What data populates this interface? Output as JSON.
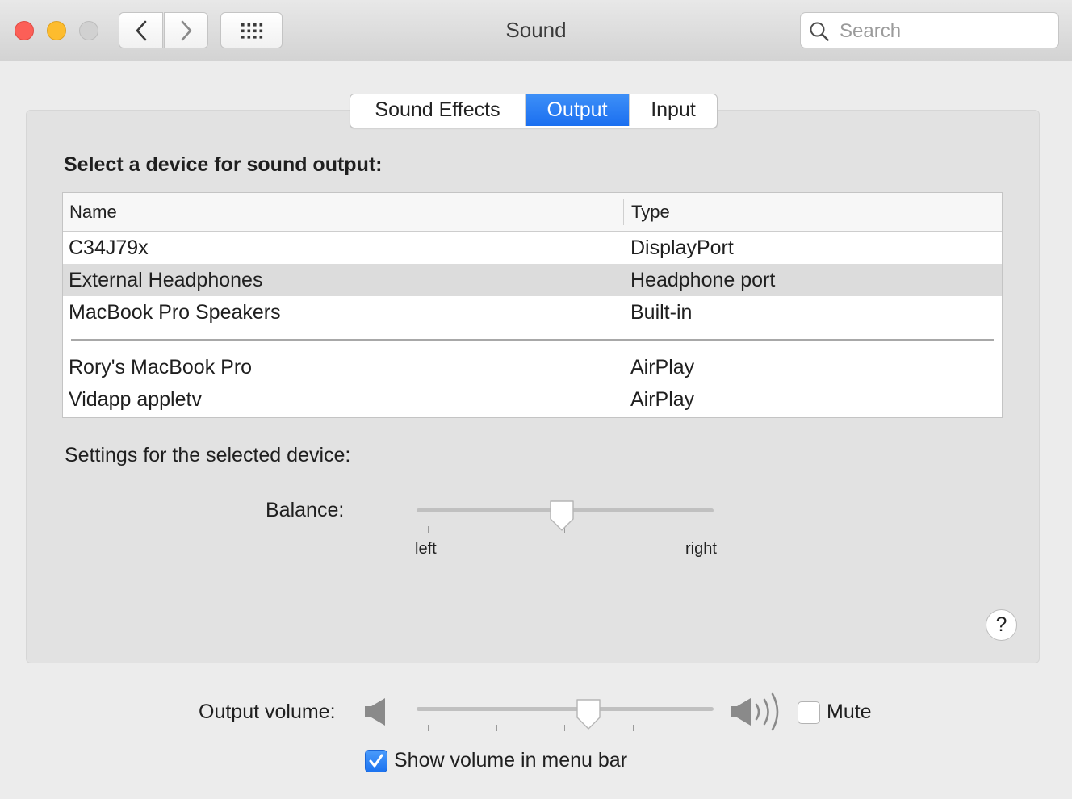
{
  "window": {
    "title": "Sound",
    "traffic_lights": {
      "close": "#fc5f57",
      "minimize": "#fdbc2e",
      "zoom": "#d1d1d1"
    },
    "back_icon": "chevron-left-icon",
    "forward_icon": "chevron-right-icon",
    "grid_icon": "show-all-grid-icon"
  },
  "search": {
    "placeholder": "Search",
    "value": ""
  },
  "tabs": [
    {
      "label": "Sound Effects",
      "active": false
    },
    {
      "label": "Output",
      "active": true
    },
    {
      "label": "Input",
      "active": false
    }
  ],
  "accent_color": "#1b6ff0",
  "output": {
    "heading": "Select a device for sound output:",
    "columns": {
      "name": "Name",
      "type": "Type"
    },
    "devices": [
      {
        "name": "C34J79x",
        "type": "DisplayPort",
        "selected": false
      },
      {
        "name": "External Headphones",
        "type": "Headphone port",
        "selected": true
      },
      {
        "name": "MacBook Pro Speakers",
        "type": "Built-in",
        "selected": false
      }
    ],
    "airplay_devices": [
      {
        "name": "Rory's MacBook Pro",
        "type": "AirPlay"
      },
      {
        "name": "Vidapp appletv",
        "type": "AirPlay"
      }
    ]
  },
  "settings": {
    "heading": "Settings for the selected device:",
    "balance": {
      "label": "Balance:",
      "left_label": "left",
      "right_label": "right",
      "value": 0.49
    }
  },
  "help_button": {
    "label": "?"
  },
  "volume": {
    "label": "Output volume:",
    "value": 0.58,
    "low_icon": "speaker-low-icon",
    "high_icon": "speaker-high-icon"
  },
  "mute": {
    "label": "Mute",
    "checked": false
  },
  "show_in_menu_bar": {
    "label": "Show volume in menu bar",
    "checked": true
  }
}
